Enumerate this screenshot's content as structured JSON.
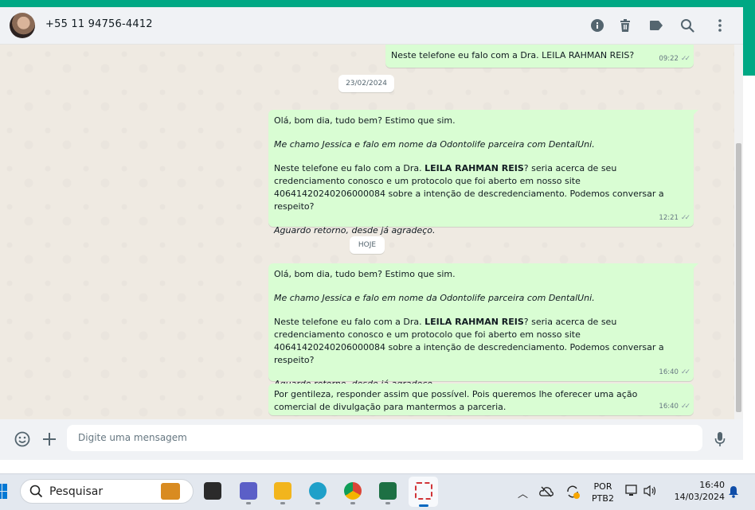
{
  "header": {
    "contact_name": "+55 11 94756-4412",
    "icons": [
      "info-icon",
      "trash-icon",
      "label-icon",
      "search-icon",
      "menu-icon"
    ]
  },
  "messages": [
    {
      "id": "m0",
      "lines": [
        "Neste telefone eu falo com a Dra. LEILA RAHMAN REIS?"
      ],
      "time": "09:22"
    },
    {
      "id": "m1",
      "greeting": "Olá, bom dia, tudo bem? Estimo que sim.",
      "intro": "Me chamo Jessica e falo em nome da Odontolife parceira com DentalUni.",
      "body_prefix": "Neste telefone eu falo com a Dra. ",
      "body_bold": "LEILA RAHMAN REIS",
      "body_suffix": "? seria acerca de seu credenciamento conosco e um protocolo que foi aberto em nosso site 40641420240206000084 sobre a intenção de descredenciamento. Podemos conversar a respeito?",
      "closing": "Aguardo retorno, desde já agradeço.",
      "time": "12:21"
    },
    {
      "id": "m2",
      "greeting": "Olá, bom dia, tudo bem? Estimo que sim.",
      "intro": "Me chamo Jessica e falo em nome da Odontolife parceira com DentalUni.",
      "body_prefix": "Neste telefone eu falo com a Dra. ",
      "body_bold": "LEILA RAHMAN REIS",
      "body_suffix": "? seria acerca de seu credenciamento conosco e um protocolo que foi aberto em nosso site 40641420240206000084 sobre a intenção de descredenciamento. Podemos conversar a respeito?",
      "closing": "Aguardo retorno, desde já agradeço.",
      "time": "16:40"
    },
    {
      "id": "m3",
      "text": "Por gentileza, responder assim que possível. Pois queremos lhe oferecer uma ação comercial de divulgação para mantermos a parceria.",
      "time": "16:40"
    }
  ],
  "date_chips": {
    "first": "23/02/2024",
    "second": "HOJE"
  },
  "ticks": "✓✓",
  "footer": {
    "placeholder": "Digite uma mensagem"
  },
  "taskbar": {
    "search_label": "Pesquisar",
    "language_line1": "POR",
    "language_line2": "PTB2",
    "clock_time": "16:40",
    "clock_date": "14/03/2024"
  },
  "colors": {
    "accent": "#00a884",
    "outgoing_bubble": "#d9fdd3",
    "chat_background": "#efeae2"
  }
}
